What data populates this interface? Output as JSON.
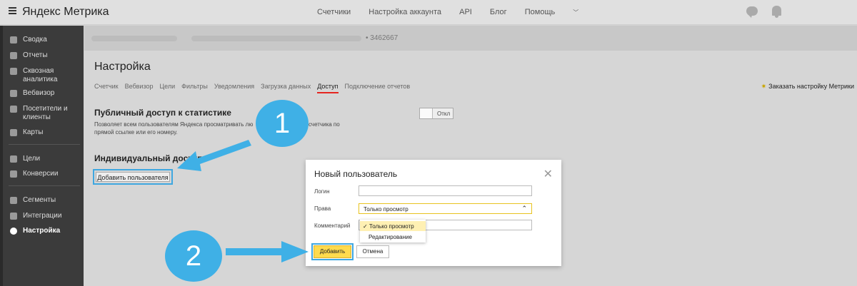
{
  "header": {
    "logo": "Яндекс Метрика",
    "nav": [
      "Счетчики",
      "Настройка аккаунта",
      "API",
      "Блог",
      "Помощь"
    ]
  },
  "sidebar": {
    "items": [
      {
        "label": "Сводка",
        "icon": "gauge-icon"
      },
      {
        "label": "Отчеты",
        "icon": "bar-chart-icon"
      },
      {
        "label": "Сквозная аналитика",
        "icon": "flow-icon"
      },
      {
        "label": "Вебвизор",
        "icon": "play-icon"
      },
      {
        "label": "Посетители и клиенты",
        "icon": "people-icon"
      },
      {
        "label": "Карты",
        "icon": "map-icon"
      },
      {
        "label": "Цели",
        "icon": "target-icon"
      },
      {
        "label": "Конверсии",
        "icon": "conversion-icon"
      },
      {
        "label": "Сегменты",
        "icon": "funnel-icon"
      },
      {
        "label": "Интеграции",
        "icon": "puzzle-icon"
      },
      {
        "label": "Настройка",
        "icon": "gear-icon"
      }
    ]
  },
  "counter": {
    "id": "• 3462667"
  },
  "page": {
    "title": "Настройка",
    "tabs": [
      "Счетчик",
      "Вебвизор",
      "Цели",
      "Фильтры",
      "Уведомления",
      "Загрузка данных",
      "Доступ",
      "Подключение отчетов"
    ],
    "active_tab": "Доступ",
    "order_link": "Заказать настройку Метрики"
  },
  "public_access": {
    "heading": "Публичный доступ к статистике",
    "desc_1": "Позволяет всем пользователям Яндекса просматривать лю",
    "desc_2": "счетчика по",
    "desc_3": "прямой ссылке или его номеру.",
    "toggle_label": "Откл"
  },
  "individual_access": {
    "heading": "Индивидуальный доступ",
    "add_button": "Добавить пользователя"
  },
  "modal": {
    "title": "Новый пользователь",
    "login_label": "Логин",
    "rights_label": "Права",
    "rights_value": "Только просмотр",
    "comment_label": "Комментарий",
    "options": [
      "✓ Только просмотр",
      "Редактирование"
    ],
    "add_button": "Добавить",
    "cancel_button": "Отмена"
  },
  "callouts": {
    "one": "1",
    "two": "2"
  },
  "colors": {
    "accent": "#3fb0e6",
    "brand_red": "#e52620",
    "yellow_button": "#ffdb4d"
  }
}
